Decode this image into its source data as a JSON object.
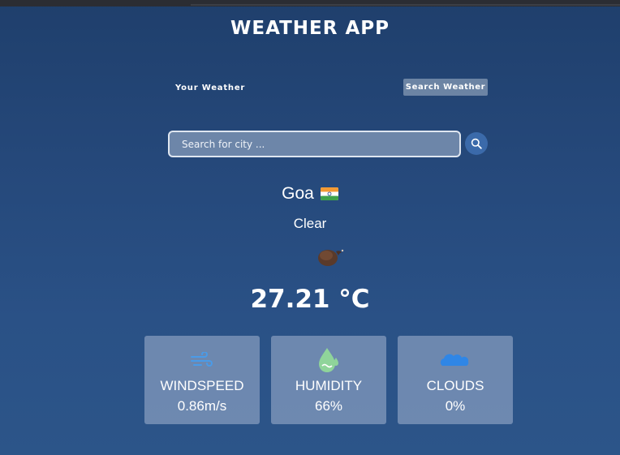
{
  "app": {
    "title": "WEATHER APP"
  },
  "tabs": {
    "your_weather": "Your Weather",
    "search_weather": "Search Weather"
  },
  "search": {
    "placeholder": "Search for city ...",
    "value": ""
  },
  "weather": {
    "city": "Goa",
    "country_flag": "flag-india-icon",
    "condition": "Clear",
    "condition_icon": "clear-night-icon",
    "temperature": "27.21 °C"
  },
  "stats": [
    {
      "icon": "wind-icon",
      "label": "WINDSPEED",
      "value": "0.86m/s"
    },
    {
      "icon": "humidity-drop-icon",
      "label": "HUMIDITY",
      "value": "66%"
    },
    {
      "icon": "cloud-icon",
      "label": "CLOUDS",
      "value": "0%"
    }
  ],
  "colors": {
    "background": "#25487a",
    "accent_button": "#3b6aaa",
    "icon_blue": "#4a9be8",
    "humidity_green": "#8fd49a"
  }
}
